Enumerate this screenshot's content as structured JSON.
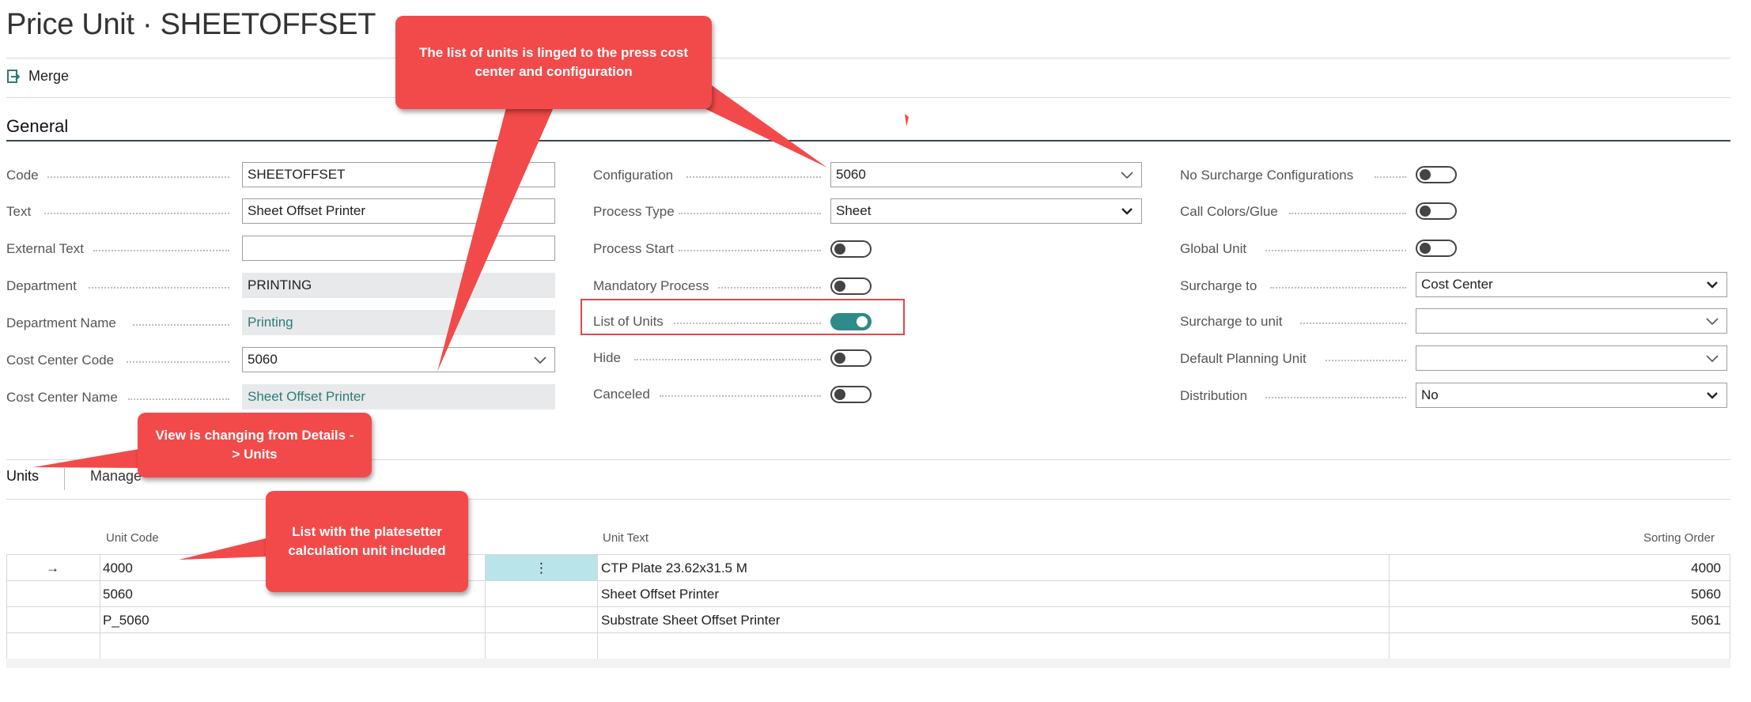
{
  "page": {
    "title": "Price Unit · SHEETOFFSET"
  },
  "actions": {
    "merge_label": "Merge"
  },
  "general": {
    "section_title": "General",
    "col1": [
      {
        "label": "Code",
        "value": "SHEETOFFSET",
        "type": "text"
      },
      {
        "label": "Text",
        "value": "Sheet Offset Printer",
        "type": "text"
      },
      {
        "label": "External Text",
        "value": "",
        "type": "text"
      },
      {
        "label": "Department",
        "value": "PRINTING",
        "type": "readonly"
      },
      {
        "label": "Department Name",
        "value": "Printing",
        "type": "readonly-link"
      },
      {
        "label": "Cost Center Code",
        "value": "5060",
        "type": "dropdown"
      },
      {
        "label": "Cost Center Name",
        "value": "Sheet Offset Printer",
        "type": "readonly-link"
      }
    ],
    "col2": [
      {
        "label": "Configuration",
        "value": "5060",
        "type": "dropdown"
      },
      {
        "label": "Process Type",
        "value": "Sheet",
        "type": "select"
      },
      {
        "label": "Process Start",
        "value": false,
        "type": "toggle"
      },
      {
        "label": "Mandatory Process",
        "value": false,
        "type": "toggle"
      },
      {
        "label": "List of Units",
        "value": true,
        "type": "toggle"
      },
      {
        "label": "Hide",
        "value": false,
        "type": "toggle"
      },
      {
        "label": "Canceled",
        "value": false,
        "type": "toggle"
      }
    ],
    "col3": [
      {
        "label": "No Surcharge Configurations",
        "value": false,
        "type": "toggle"
      },
      {
        "label": "Call Colors/Glue",
        "value": false,
        "type": "toggle"
      },
      {
        "label": "Global Unit",
        "value": false,
        "type": "toggle"
      },
      {
        "label": "Surcharge to",
        "value": "Cost Center",
        "type": "select"
      },
      {
        "label": "Surcharge to unit",
        "value": "",
        "type": "dropdown"
      },
      {
        "label": "Default Planning Unit",
        "value": "",
        "type": "dropdown"
      },
      {
        "label": "Distribution",
        "value": "No",
        "type": "select"
      }
    ]
  },
  "subpage": {
    "tabs": [
      "Units",
      "Manage"
    ],
    "columns": {
      "unit_code": "Unit Code",
      "unit_text": "Unit Text",
      "sorting_order": "Sorting Order"
    },
    "rows": [
      {
        "arrow": "→",
        "unit_code": "4000",
        "unit_text": "CTP Plate 23.62x31.5 M",
        "sorting_order": "4000"
      },
      {
        "arrow": "",
        "unit_code": "5060",
        "unit_text": "Sheet Offset Printer",
        "sorting_order": "5060"
      },
      {
        "arrow": "",
        "unit_code": "P_5060",
        "unit_text": "Substrate Sheet Offset Printer",
        "sorting_order": "5061"
      }
    ],
    "row_menu_icon": "⋮"
  },
  "callouts": {
    "top": "The list of units is linged to the press cost center and configuration",
    "view": "View is changing from Details -> Units",
    "list": "List with the platesetter calculation unit included"
  },
  "colors": {
    "accent": "#2f8a8a",
    "callout": "#f24a4a",
    "highlight_box": "#e04848"
  }
}
